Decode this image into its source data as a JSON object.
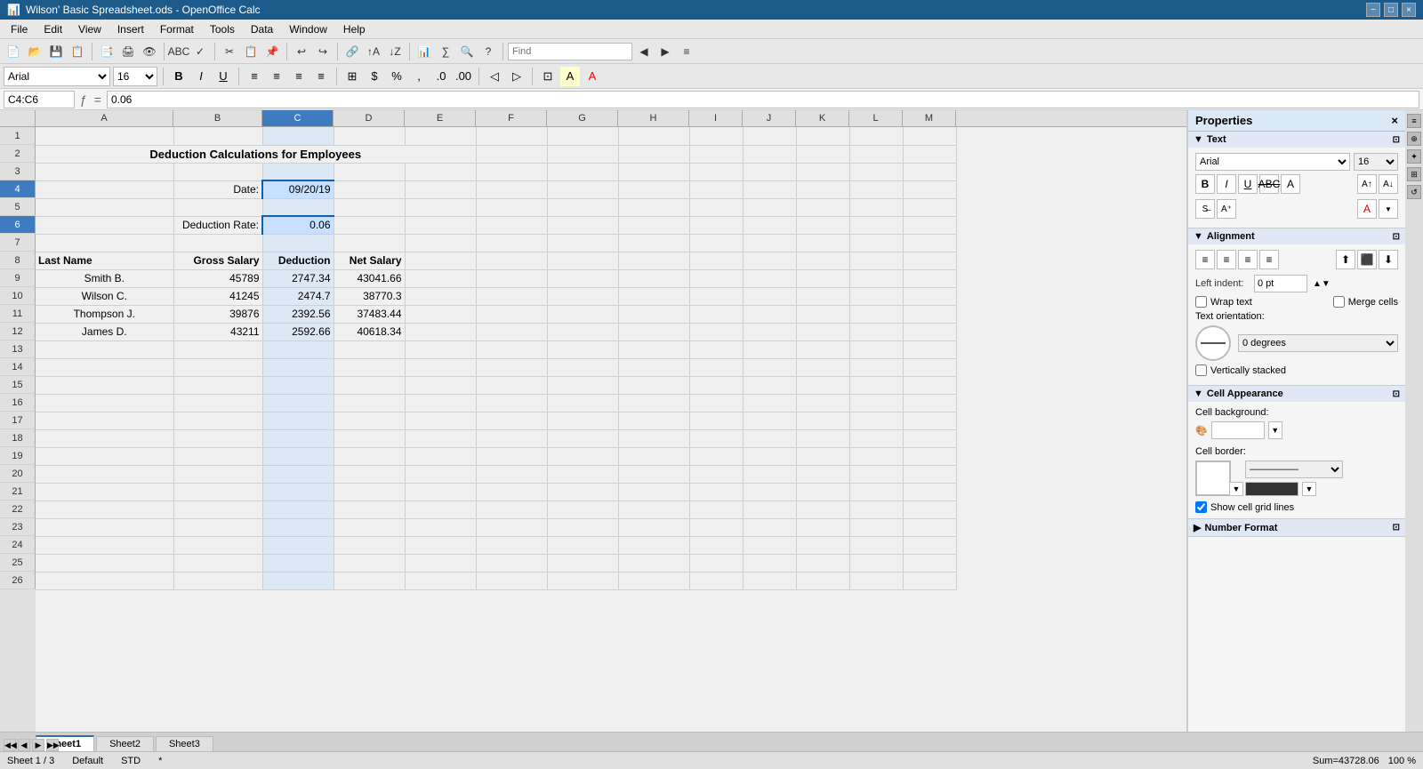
{
  "titlebar": {
    "title": "Wilson' Basic Spreadsheet.ods - OpenOffice Calc",
    "app_icon": "📊",
    "minimize": "−",
    "maximize": "□",
    "close": "×"
  },
  "menu": {
    "items": [
      "File",
      "Edit",
      "View",
      "Insert",
      "Format",
      "Tools",
      "Data",
      "Window",
      "Help"
    ]
  },
  "formula_bar": {
    "cell_ref": "C4:C6",
    "formula_value": "0.06"
  },
  "spreadsheet": {
    "title": "Deduction Calculations for Employees",
    "date_label": "Date:",
    "date_value": "09/20/19",
    "deduction_rate_label": "Deduction Rate:",
    "deduction_rate_value": "0.06",
    "columns": [
      "",
      "A",
      "B",
      "C",
      "D",
      "E",
      "F",
      "G",
      "H",
      "I",
      "J",
      "K",
      "L",
      "M"
    ],
    "headers": {
      "last_name": "Last Name",
      "gross_salary": "Gross Salary",
      "deduction": "Deduction",
      "net_salary": "Net Salary"
    },
    "employees": [
      {
        "last_name": "Smith B.",
        "gross_salary": "45789",
        "deduction": "2747.34",
        "net_salary": "43041.66"
      },
      {
        "last_name": "Wilson C.",
        "gross_salary": "41245",
        "deduction": "2474.7",
        "net_salary": "38770.3"
      },
      {
        "last_name": "Thompson J.",
        "gross_salary": "39876",
        "deduction": "2392.56",
        "net_salary": "37483.44"
      },
      {
        "last_name": "James D.",
        "gross_salary": "43211",
        "deduction": "2592.66",
        "net_salary": "40618.34"
      }
    ]
  },
  "properties": {
    "title": "Properties",
    "sections": {
      "text": {
        "label": "Text",
        "font": "Arial",
        "font_size": "16",
        "bold": "B",
        "italic": "I",
        "underline": "U",
        "strikethrough": "ABC",
        "shadow": "A"
      },
      "alignment": {
        "label": "Alignment",
        "left_indent_label": "Left indent:",
        "left_indent_value": "0 pt",
        "wrap_text": "Wrap text",
        "merge_cells": "Merge cells",
        "orientation_label": "Text orientation:",
        "orientation_value": "0 degrees",
        "vertically_stacked": "Vertically stacked"
      },
      "cell_appearance": {
        "label": "Cell Appearance",
        "bg_label": "Cell background:",
        "border_label": "Cell border:",
        "show_grid_lines": "Show cell grid lines"
      },
      "number_format": {
        "label": "Number Format"
      }
    }
  },
  "sheets": {
    "tabs": [
      "Sheet1",
      "Sheet2",
      "Sheet3"
    ],
    "active": "Sheet1"
  },
  "statusbar": {
    "sheet_info": "Sheet 1 / 3",
    "style": "Default",
    "mode": "STD",
    "sum_label": "Sum=43728.06",
    "zoom": "100 %"
  }
}
